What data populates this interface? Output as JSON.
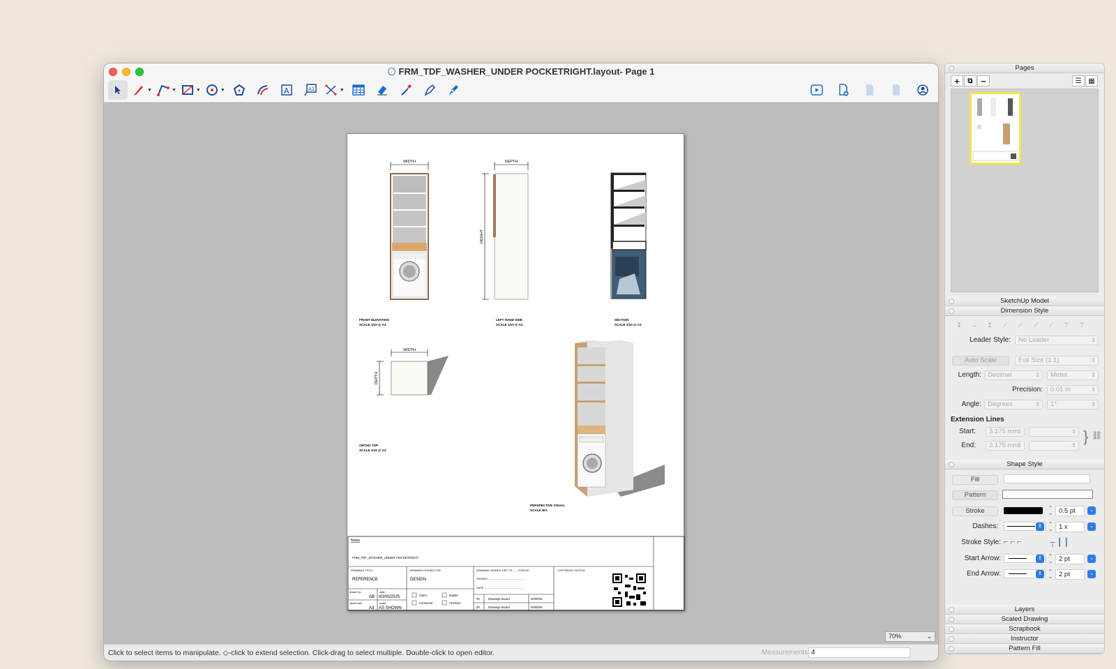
{
  "window": {
    "title": "FRM_TDF_WASHER_UNDER POCKETRIGHT.layout- Page 1"
  },
  "toolbar": {
    "tools": [
      "select-tool",
      "pencil-tool",
      "line-tool",
      "rectangle-tool",
      "circle-tool",
      "polygon-tool",
      "offset-tool",
      "text-tool",
      "label-tool",
      "dimension-tool",
      "table-tool",
      "eraser-tool",
      "style-tool",
      "split-tool",
      "join-tool"
    ],
    "right_tools": [
      "presentation-tool",
      "add-page-tool",
      "previous-page-tool",
      "next-page-tool",
      "account-tool"
    ]
  },
  "drawing": {
    "labels": {
      "front_dim": "WIDTH",
      "side_dim": "DEPTH",
      "side_height": "HEIGHT",
      "top_width": "WIDTH",
      "top_depth": "DEPTH",
      "front_title": "FRONT ELEVATION",
      "front_scale": "SCALE 1/10 @ A3",
      "side_title": "LEFT HAND SIDE",
      "side_scale": "SCALE 1/10 @ A3",
      "section_title": "SECTION",
      "section_scale": "SCALE 1/10 @ A3",
      "top_title": "ORTHO TOP",
      "top_scale": "SCALE 1/10 @ A3",
      "persp_title": "PERSPECTIVE VISUAL",
      "persp_scale": "SCALE N/A"
    },
    "titleblock": {
      "notes": "Notes",
      "project": "FRM_TDF_WASHER_UNDER POCKETRIGHT",
      "drawing_title_label": "DRAWING TITLE",
      "drawing_title": "REFERENCE",
      "issued_for_label": "DRAWING ISSUED FOR",
      "issued_for": "DESIGN",
      "signed_off_label": "DRAWING SIGNED OFF TO....... STATUS",
      "signed": "SIGNED ...............................................",
      "date_line": "DATE.....................................................",
      "copyright": "COPYRIGHT NOTICE",
      "drawn_by_label": "drawn by",
      "drawn_by": "AB",
      "date_label": "date",
      "date": "00/00/2025",
      "sheet_size_label": "sheet size",
      "sheet_size": "A3",
      "scale_label": "scale",
      "scale": "AS SHOWN",
      "client": "Client",
      "builder": "Builder",
      "contractor": "Contractor",
      "architect": "Architect",
      "rev_rows": [
        {
          "rev": "00",
          "desc": "Drawings issued",
          "date": "00/00/00"
        },
        {
          "rev": "00",
          "desc": "Drawings issued",
          "date": "00/00/00"
        }
      ]
    }
  },
  "zoom": "70%",
  "status": {
    "hint": "Click to select items to manipulate. ◇-click to extend selection. Click-drag to select multiple. Double-click to open editor.",
    "measurements_label": "Measurements",
    "measurements_value": "4"
  },
  "panel": {
    "pages_title": "Pages",
    "sketchup_title": "SketchUp Model",
    "dimension_title": "Dimension Style",
    "leader_style_label": "Leader Style:",
    "leader_style_value": "No Leader",
    "auto_scale": "Auto Scale",
    "full_size": "Full Size (1:1)",
    "length_label": "Length:",
    "length_format": "Decimal",
    "length_unit": "Meter",
    "precision_label": "Precision:",
    "precision_value": "0.01 m",
    "angle_label": "Angle:",
    "angle_unit": "Degrees",
    "angle_precision": "1°",
    "extension_title": "Extension Lines",
    "start_label": "Start:",
    "start_value": "3.175 mm",
    "end_label": "End:",
    "end_value": "3.175 mm",
    "shape_title": "Shape Style",
    "fill": "Fill",
    "pattern": "Pattern",
    "stroke": "Stroke",
    "stroke_width": "0.5 pt",
    "dashes_label": "Dashes:",
    "dash_scale": "1 x",
    "stroke_style_label": "Stroke Style:",
    "start_arrow_label": "Start Arrow:",
    "start_arrow_size": "2 pt",
    "end_arrow_label": "End Arrow:",
    "end_arrow_size": "2 pt",
    "collapsed": [
      "Layers",
      "Scaled Drawing",
      "Scrapbook",
      "Instructor",
      "Pattern Fill"
    ]
  }
}
